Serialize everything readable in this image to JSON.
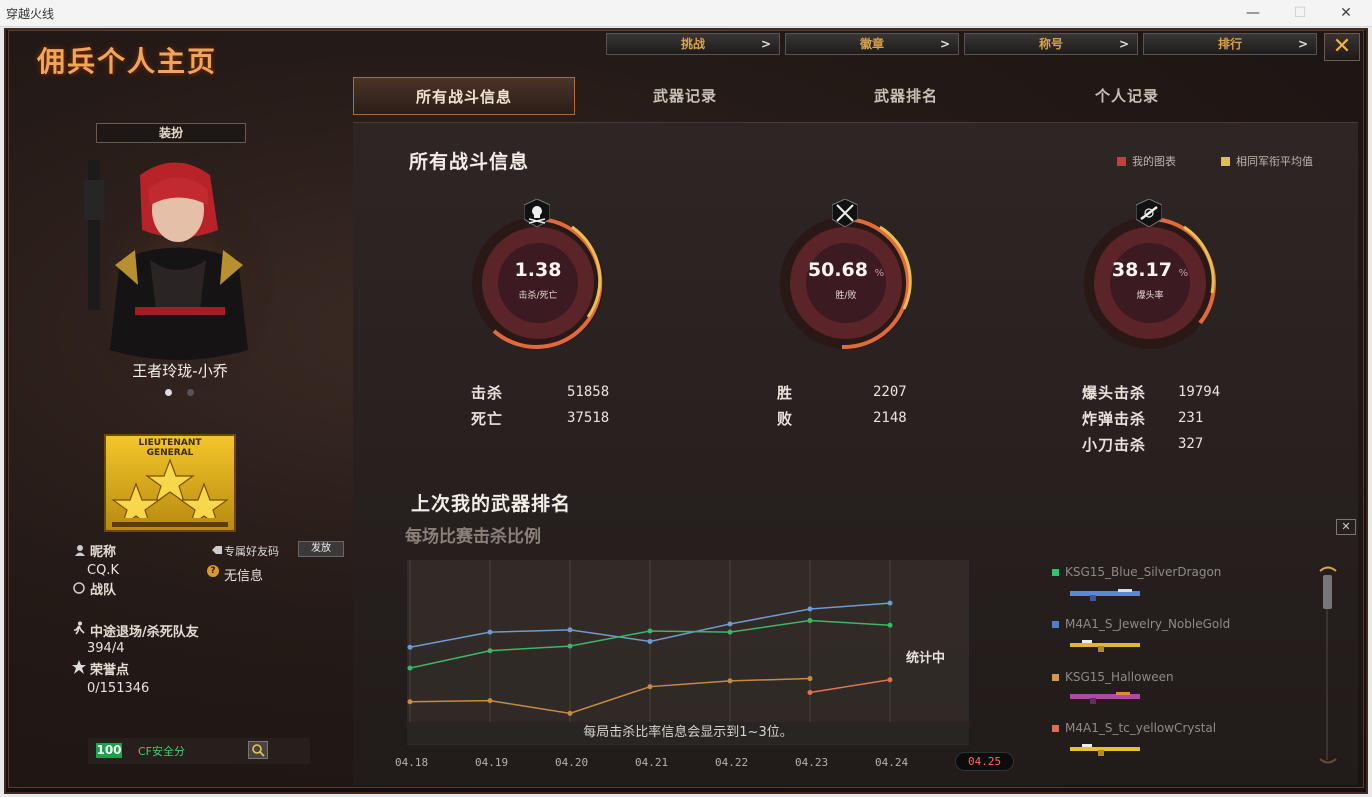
{
  "window": {
    "title": "穿越火线",
    "minimize": "—",
    "maximize": "☐",
    "close": "✕"
  },
  "page_title": "佣兵个人主页",
  "topnav": [
    {
      "label": "挑战",
      "arrow": ">"
    },
    {
      "label": "徽章",
      "arrow": ">"
    },
    {
      "label": "称号",
      "arrow": ">"
    },
    {
      "label": "排行",
      "arrow": ">"
    }
  ],
  "close_label": "✕",
  "tabs": [
    "所有战斗信息",
    "武器记录",
    "武器排名",
    "个人记录"
  ],
  "left": {
    "outfit_button": "装扮",
    "character_name": "王者玲珑-小乔",
    "rank_text_1": "LIEUTENANT",
    "rank_text_2": "GENERAL",
    "nickname_label": "昵称",
    "nickname": "CQ.K",
    "friend_code_label": "专属好友码",
    "send_button": "发放",
    "friend_code_value": "无信息",
    "team_label": "战队",
    "quit_label": "中途退场/杀死队友",
    "quit_value": "394/4",
    "honor_label": "荣誉点",
    "honor_value": "0/151346",
    "security_score": "100",
    "security_label": "CF安全分"
  },
  "main": {
    "section_title": "所有战斗信息",
    "legend_mine": "我的图表",
    "legend_avg": "相同军衔平均值",
    "gauges": [
      {
        "value": "1.38",
        "pct": "",
        "label": "击杀/死亡"
      },
      {
        "value": "50.68",
        "pct": "%",
        "label": "胜/败"
      },
      {
        "value": "38.17",
        "pct": "%",
        "label": "爆头率"
      }
    ],
    "stats": [
      {
        "k": "击杀",
        "v": "51858"
      },
      {
        "k": "死亡",
        "v": "37518"
      },
      {
        "k": "胜",
        "v": "2207"
      },
      {
        "k": "败",
        "v": "2148"
      },
      {
        "k": "爆头击杀",
        "v": "19794"
      },
      {
        "k": "炸弹击杀",
        "v": "231"
      },
      {
        "k": "小刀击杀",
        "v": "327"
      }
    ],
    "weapon_rank_title": "上次我的武器排名",
    "chart_subtitle": "每场比赛击杀比例",
    "chart_status": "统计中",
    "chart_notice": "每局击杀比率信息会显示到1~3位。",
    "weapons": [
      {
        "name": "KSG15_Blue_SilverDragon",
        "color": "#36c36a"
      },
      {
        "name": "M4A1_S_Jewelry_NobleGold",
        "color": "#4a7fd0"
      },
      {
        "name": "KSG15_Halloween",
        "color": "#d79a4a"
      },
      {
        "name": "M4A1_S_tc_yellowCrystal",
        "color": "#e06a5a"
      }
    ]
  },
  "chart_data": {
    "type": "line",
    "categories": [
      "04.18",
      "04.19",
      "04.20",
      "04.21",
      "04.22",
      "04.23",
      "04.24",
      "04.25"
    ],
    "series": [
      {
        "color": "#6f9ad0",
        "values": [
          0.61,
          0.74,
          0.76,
          0.66,
          0.81,
          0.94,
          0.99,
          null
        ]
      },
      {
        "color": "#3fb567",
        "values": [
          0.43,
          0.58,
          0.62,
          0.75,
          0.74,
          0.84,
          0.8,
          null
        ]
      },
      {
        "color": "#c58b45",
        "values": [
          0.14,
          0.15,
          0.04,
          0.27,
          0.32,
          0.34,
          null,
          null
        ]
      },
      {
        "color": "#d9764e",
        "values": [
          null,
          null,
          null,
          null,
          null,
          0.22,
          0.33,
          null
        ]
      }
    ],
    "ylim": [
      0,
      1
    ],
    "current": "04.25"
  }
}
